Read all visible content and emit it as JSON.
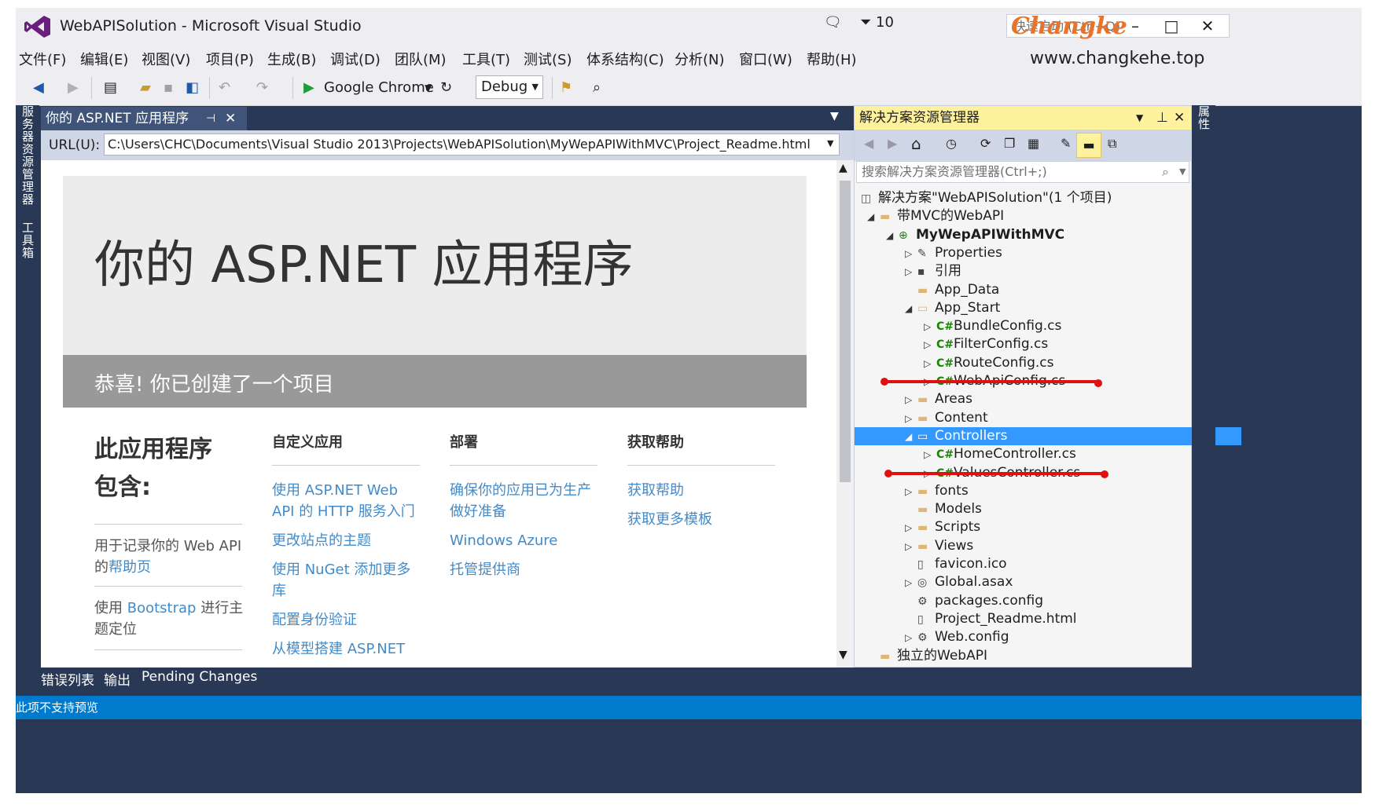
{
  "window": {
    "title": "WebAPISolution - Microsoft Visual Studio",
    "notification_count": "10",
    "quick_launch_placeholder": "快速启动 (Ctrl+Q)",
    "min": "–",
    "max": "□",
    "close": "✕"
  },
  "watermark": {
    "brand": "Changke",
    "url": "www.changkehe.top"
  },
  "menu": [
    "文件(F)",
    "编辑(E)",
    "视图(V)",
    "项目(P)",
    "生成(B)",
    "调试(D)",
    "团队(M)",
    "工具(T)",
    "测试(S)",
    "体系结构(C)",
    "分析(N)",
    "窗口(W)",
    "帮助(H)"
  ],
  "toolbar": {
    "run_target": "Google Chrome",
    "config": "Debug"
  },
  "left_strip": {
    "server_explorer": "服务器资源管理器",
    "toolbox": "工具箱"
  },
  "right_strip": {
    "properties": "属性"
  },
  "doc_tab": {
    "label": "你的 ASP.NET 应用程序",
    "pin": "⊣",
    "close": "✕"
  },
  "url_bar": {
    "label": "URL(U):",
    "value": "C:\\Users\\CHC\\Documents\\Visual Studio 2013\\Projects\\WebAPISolution\\MyWepAPIWithMVC\\Project_Readme.html"
  },
  "page": {
    "hero_title": "你的 ASP.NET 应用程序",
    "congrats": "恭喜! 你已创建了一个项目",
    "contains_title_1": "此应用程序",
    "contains_title_2": "包含:",
    "contains_item_1_pre": "用于记录你的 Web API 的",
    "contains_item_1_link": "帮助页",
    "contains_item_2_pre": "使用 ",
    "contains_item_2_link": "Bootstrap",
    "contains_item_2_post": " 进行主题定位",
    "columns": [
      {
        "heading": "自定义应用",
        "links": [
          "使用 ASP.NET Web API 的 HTTP 服务入门",
          "更改站点的主题",
          "使用 NuGet 添加更多库",
          "配置身份验证",
          "从模型搭建 ASP.NET"
        ]
      },
      {
        "heading": "部署",
        "links": [
          "确保你的应用已为生产做好准备",
          "Windows Azure",
          "托管提供商"
        ]
      },
      {
        "heading": "获取帮助",
        "links": [
          "获取帮助",
          "获取更多模板"
        ]
      }
    ]
  },
  "bottom_tabs": [
    "错误列表",
    "输出",
    "Pending Changes"
  ],
  "status_bar": "此项不支持预览",
  "solution_explorer": {
    "title": "解决方案资源管理器",
    "search_placeholder": "搜索解决方案资源管理器(Ctrl+;)",
    "tree": [
      {
        "label": "解决方案\"WebAPISolution\"(1 个项目)",
        "icon": "solution-icon",
        "arrow": ""
      },
      {
        "label": "带MVC的WebAPI",
        "icon": "folder-icon",
        "arrow": "◢"
      },
      {
        "label": "MyWepAPIWithMVC",
        "icon": "web-project-icon",
        "arrow": "◢",
        "bold": true
      },
      {
        "label": "Properties",
        "icon": "wrench-icon",
        "arrow": "▷"
      },
      {
        "label": "引用",
        "icon": "references-icon",
        "arrow": "▷"
      },
      {
        "label": "App_Data",
        "icon": "folder-icon",
        "arrow": ""
      },
      {
        "label": "App_Start",
        "icon": "folder-open-icon",
        "arrow": "◢"
      },
      {
        "label": "BundleConfig.cs",
        "icon": "csharp-icon",
        "arrow": "▷"
      },
      {
        "label": "FilterConfig.cs",
        "icon": "csharp-icon",
        "arrow": "▷"
      },
      {
        "label": "RouteConfig.cs",
        "icon": "csharp-icon",
        "arrow": "▷"
      },
      {
        "label": "WebApiConfig.cs",
        "icon": "csharp-icon",
        "arrow": "▷"
      },
      {
        "label": "Areas",
        "icon": "folder-icon",
        "arrow": "▷"
      },
      {
        "label": "Content",
        "icon": "folder-icon",
        "arrow": "▷"
      },
      {
        "label": "Controllers",
        "icon": "folder-open-icon",
        "arrow": "◢",
        "selected": true
      },
      {
        "label": "HomeController.cs",
        "icon": "csharp-icon",
        "arrow": "▷"
      },
      {
        "label": "ValuesController.cs",
        "icon": "csharp-icon",
        "arrow": "▷"
      },
      {
        "label": "fonts",
        "icon": "folder-icon",
        "arrow": "▷"
      },
      {
        "label": "Models",
        "icon": "folder-icon",
        "arrow": ""
      },
      {
        "label": "Scripts",
        "icon": "folder-icon",
        "arrow": "▷"
      },
      {
        "label": "Views",
        "icon": "folder-icon",
        "arrow": "▷"
      },
      {
        "label": "favicon.ico",
        "icon": "file-icon",
        "arrow": ""
      },
      {
        "label": "Global.asax",
        "icon": "global-asax-icon",
        "arrow": "▷"
      },
      {
        "label": "packages.config",
        "icon": "config-icon",
        "arrow": ""
      },
      {
        "label": "Project_Readme.html",
        "icon": "html-file-icon",
        "arrow": ""
      },
      {
        "label": "Web.config",
        "icon": "config-icon",
        "arrow": "▷"
      },
      {
        "label": "独立的WebAPI",
        "icon": "folder-icon",
        "arrow": ""
      }
    ]
  },
  "colors": {
    "accent": "#007acc",
    "selection": "#3399ff",
    "frame": "#293955",
    "annotation": "#e01010",
    "link": "#428bca"
  }
}
